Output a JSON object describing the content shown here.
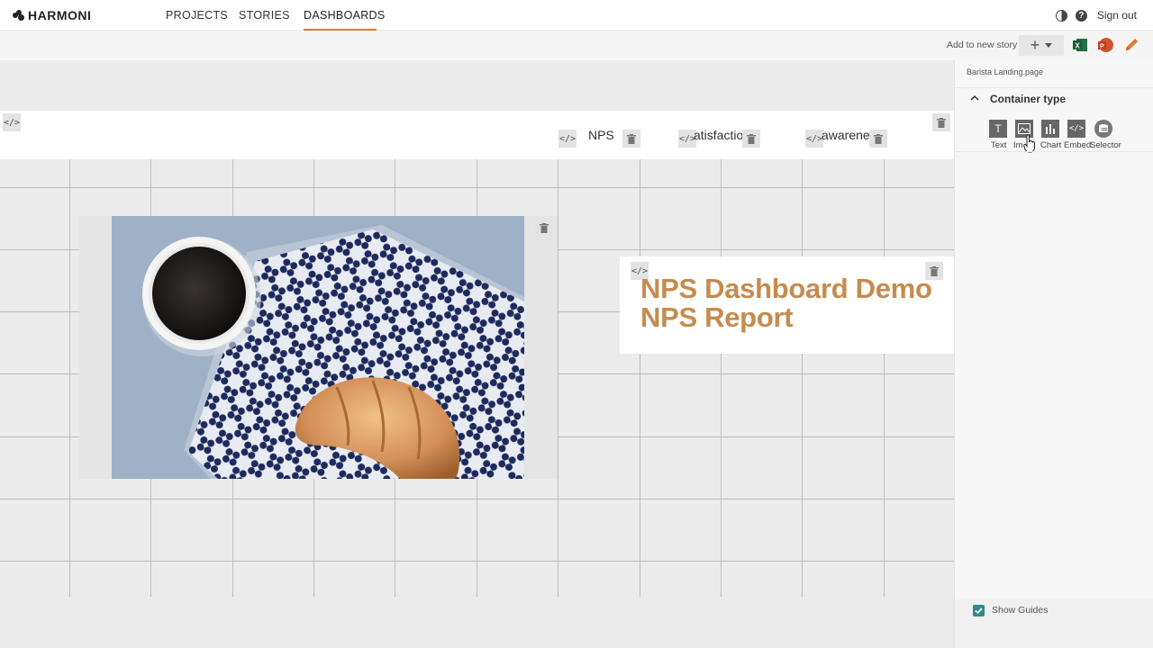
{
  "app": {
    "name": "HARMONI"
  },
  "nav": {
    "tabs": [
      {
        "label": "PROJECTS"
      },
      {
        "label": "STORIES"
      },
      {
        "label": "DASHBOARDS",
        "active": true
      }
    ],
    "signout": "Sign out",
    "accent": "#e87722"
  },
  "toolbar": {
    "add_to_story": "Add to new story",
    "icons": [
      "plus-icon",
      "chevron-down-icon",
      "excel-icon",
      "powerpoint-icon",
      "pencil-icon"
    ]
  },
  "canvas": {
    "header_tabs": [
      {
        "label": "NPS"
      },
      {
        "label": "atisfactio"
      },
      {
        "label": "awarenes"
      }
    ],
    "text_block": {
      "line1": "NPS Dashboard Demo",
      "line2": "NPS Report",
      "color": "#c58b4f"
    }
  },
  "panel": {
    "page_name": "Barista Landing.page",
    "section_title": "Container type",
    "container_types": [
      {
        "label": "Text",
        "icon": "text-icon"
      },
      {
        "label": "Im",
        "icon": "image-icon"
      },
      {
        "label": "Chart",
        "icon": "chart-icon"
      },
      {
        "label": "Embed",
        "icon": "embed-icon"
      },
      {
        "label": "Selector",
        "icon": "selector-icon"
      }
    ],
    "show_guides": "Show Guides"
  }
}
